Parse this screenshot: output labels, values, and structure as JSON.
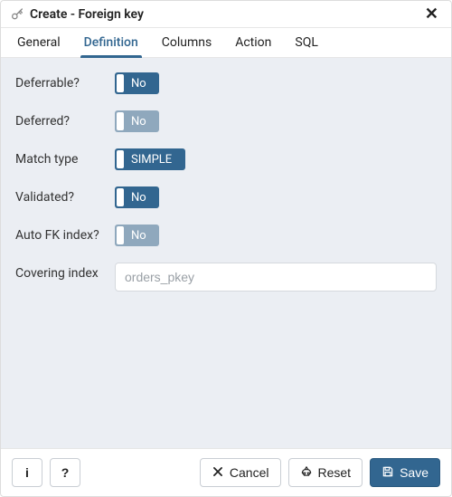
{
  "header": {
    "title": "Create - Foreign key",
    "close_glyph": "✕"
  },
  "tabs": {
    "general": "General",
    "definition": "Definition",
    "columns": "Columns",
    "action": "Action",
    "sql": "SQL",
    "active": "definition"
  },
  "form": {
    "deferrable": {
      "label": "Deferrable?",
      "value": "No",
      "enabled": true
    },
    "deferred": {
      "label": "Deferred?",
      "value": "No",
      "enabled": false
    },
    "match_type": {
      "label": "Match type",
      "value": "SIMPLE",
      "enabled": true
    },
    "validated": {
      "label": "Validated?",
      "value": "No",
      "enabled": true
    },
    "auto_fk": {
      "label": "Auto FK index?",
      "value": "No",
      "enabled": false
    },
    "covering": {
      "label": "Covering index",
      "placeholder": "orders_pkey",
      "value": ""
    }
  },
  "footer": {
    "info_glyph": "i",
    "help_glyph": "?",
    "cancel": "Cancel",
    "reset": "Reset",
    "save": "Save"
  },
  "icons": {
    "key": "key-icon",
    "close_x": "✕",
    "reset": "♻",
    "save": "💾"
  }
}
